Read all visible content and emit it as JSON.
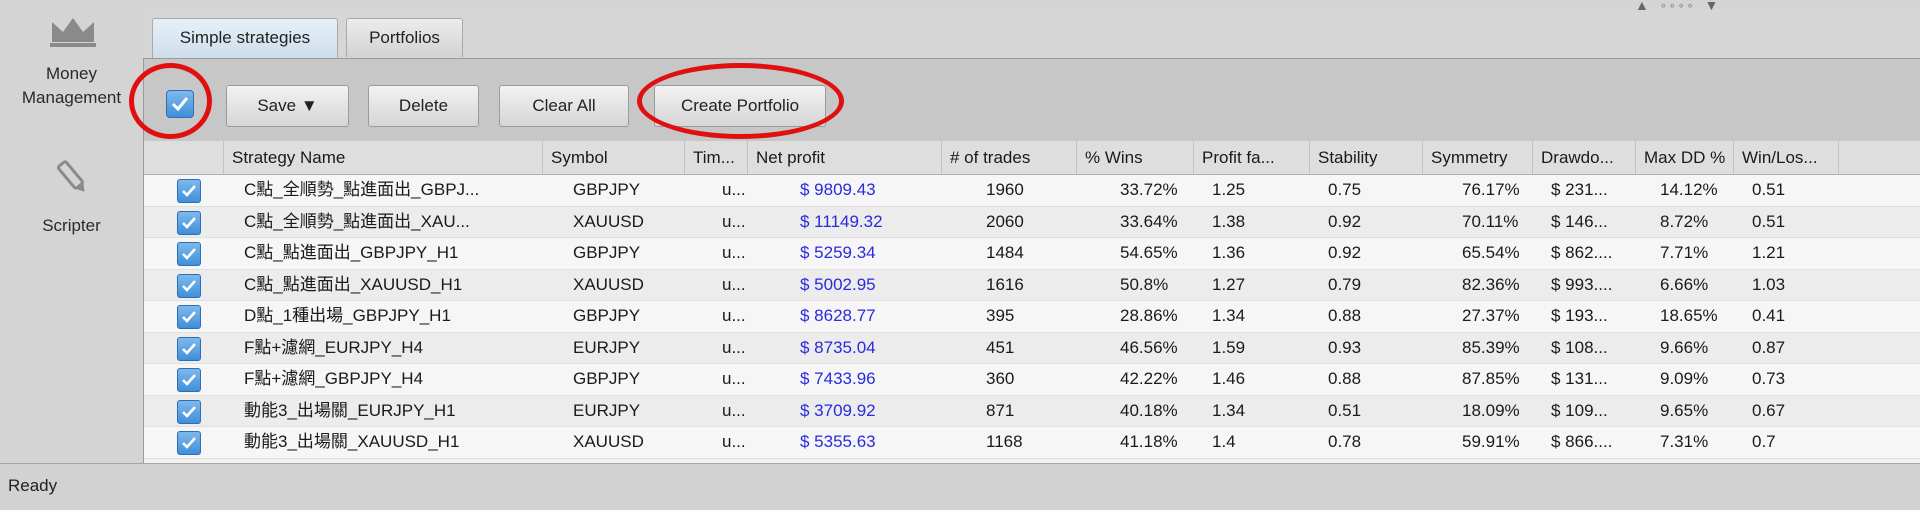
{
  "sidebar": {
    "money_management": {
      "icon": "crown-icon",
      "label_line1": "Money",
      "label_line2": "Management"
    },
    "scripter": {
      "icon": "pencil-icon",
      "label": "Scripter"
    }
  },
  "tabs": [
    {
      "label": "Simple strategies",
      "active": true
    },
    {
      "label": "Portfolios",
      "active": false
    }
  ],
  "toolbar": {
    "select_all_checked": true,
    "save_label": "Save ▼",
    "delete_label": "Delete",
    "clear_all_label": "Clear All",
    "create_portfolio_label": "Create Portfolio"
  },
  "table": {
    "columns": [
      "Strategy Name",
      "Symbol",
      "Tim...",
      "Net profit",
      "# of trades",
      "% Wins",
      "Profit fa...",
      "Stability",
      "Symmetry",
      "Drawdo...",
      "Max DD %",
      "Win/Los..."
    ],
    "rows": [
      {
        "checked": true,
        "name": "C點_全順勢_點進面出_GBPJ...",
        "symbol": "GBPJPY",
        "time": "u...",
        "net_profit": "$ 9809.43",
        "trades": "1960",
        "wins": "33.72%",
        "profit_factor": "1.25",
        "stability": "0.75",
        "symmetry": "76.17%",
        "drawdown": "$ 231...",
        "max_dd": "14.12%",
        "win_loss": "0.51"
      },
      {
        "checked": true,
        "name": "C點_全順勢_點進面出_XAU...",
        "symbol": "XAUUSD",
        "time": "u...",
        "net_profit": "$ 11149.32",
        "trades": "2060",
        "wins": "33.64%",
        "profit_factor": "1.38",
        "stability": "0.92",
        "symmetry": "70.11%",
        "drawdown": "$ 146...",
        "max_dd": "8.72%",
        "win_loss": "0.51"
      },
      {
        "checked": true,
        "name": "C點_點進面出_GBPJPY_H1",
        "symbol": "GBPJPY",
        "time": "u...",
        "net_profit": "$ 5259.34",
        "trades": "1484",
        "wins": "54.65%",
        "profit_factor": "1.36",
        "stability": "0.92",
        "symmetry": "65.54%",
        "drawdown": "$ 862....",
        "max_dd": "7.71%",
        "win_loss": "1.21"
      },
      {
        "checked": true,
        "name": "C點_點進面出_XAUUSD_H1",
        "symbol": "XAUUSD",
        "time": "u...",
        "net_profit": "$ 5002.95",
        "trades": "1616",
        "wins": "50.8%",
        "profit_factor": "1.27",
        "stability": "0.79",
        "symmetry": "82.36%",
        "drawdown": "$ 993....",
        "max_dd": "6.66%",
        "win_loss": "1.03"
      },
      {
        "checked": true,
        "name": "D點_1種出場_GBPJPY_H1",
        "symbol": "GBPJPY",
        "time": "u...",
        "net_profit": "$ 8628.77",
        "trades": "395",
        "wins": "28.86%",
        "profit_factor": "1.34",
        "stability": "0.88",
        "symmetry": "27.37%",
        "drawdown": "$ 193...",
        "max_dd": "18.65%",
        "win_loss": "0.41"
      },
      {
        "checked": true,
        "name": "F點+濾網_EURJPY_H4",
        "symbol": "EURJPY",
        "time": "u...",
        "net_profit": "$ 8735.04",
        "trades": "451",
        "wins": "46.56%",
        "profit_factor": "1.59",
        "stability": "0.93",
        "symmetry": "85.39%",
        "drawdown": "$ 108...",
        "max_dd": "9.66%",
        "win_loss": "0.87"
      },
      {
        "checked": true,
        "name": "F點+濾網_GBPJPY_H4",
        "symbol": "GBPJPY",
        "time": "u...",
        "net_profit": "$ 7433.96",
        "trades": "360",
        "wins": "42.22%",
        "profit_factor": "1.46",
        "stability": "0.88",
        "symmetry": "87.85%",
        "drawdown": "$ 131...",
        "max_dd": "9.09%",
        "win_loss": "0.73"
      },
      {
        "checked": true,
        "name": "動能3_出場關_EURJPY_H1",
        "symbol": "EURJPY",
        "time": "u...",
        "net_profit": "$ 3709.92",
        "trades": "871",
        "wins": "40.18%",
        "profit_factor": "1.34",
        "stability": "0.51",
        "symmetry": "18.09%",
        "drawdown": "$ 109...",
        "max_dd": "9.65%",
        "win_loss": "0.67"
      },
      {
        "checked": true,
        "name": "動能3_出場關_XAUUSD_H1",
        "symbol": "XAUUSD",
        "time": "u...",
        "net_profit": "$ 5355.63",
        "trades": "1168",
        "wins": "41.18%",
        "profit_factor": "1.4",
        "stability": "0.78",
        "symmetry": "59.91%",
        "drawdown": "$ 866....",
        "max_dd": "7.31%",
        "win_loss": "0.7"
      }
    ]
  },
  "status": {
    "text": "Ready"
  },
  "colors": {
    "net_profit": "#2a2ae0",
    "checkbox": "#4a97dd",
    "highlight_oval": "#e01010"
  }
}
